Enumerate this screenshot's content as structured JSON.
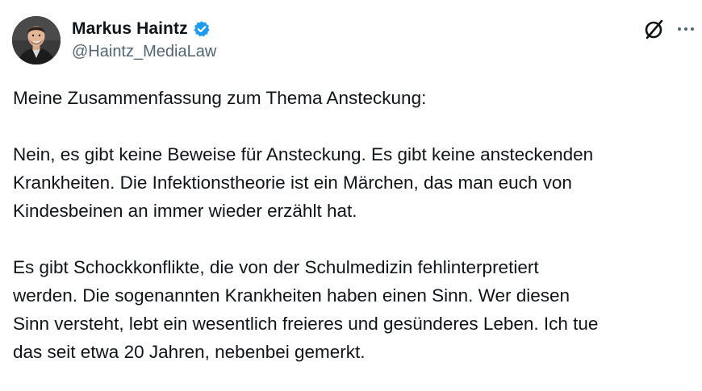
{
  "author": {
    "display_name": "Markus Haintz",
    "handle": "@Haintz_MediaLaw",
    "verified": true,
    "verified_color": "#1d9bf0"
  },
  "actions": {
    "grok_icon": "grok-icon",
    "more_icon": "more-icon"
  },
  "tweet": {
    "paragraphs": [
      [
        "Meine Zusammenfassung zum Thema Ansteckung:"
      ],
      [
        "Nein, es gibt keine Beweise für Ansteckung. Es gibt keine ansteckenden",
        "Krankheiten. Die Infektionstheorie ist ein Märchen, das man euch von",
        "Kindesbeinen an immer wieder erzählt hat."
      ],
      [
        "Es gibt Schockkonflikte, die von der Schulmedizin fehlinterpretiert",
        "werden. Die sogenannten Krankheiten haben einen Sinn. Wer diesen",
        "Sinn versteht, lebt ein wesentlich freieres und gesünderes Leben. Ich tue",
        "das seit etwa 20 Jahren, nebenbei gemerkt."
      ]
    ]
  }
}
